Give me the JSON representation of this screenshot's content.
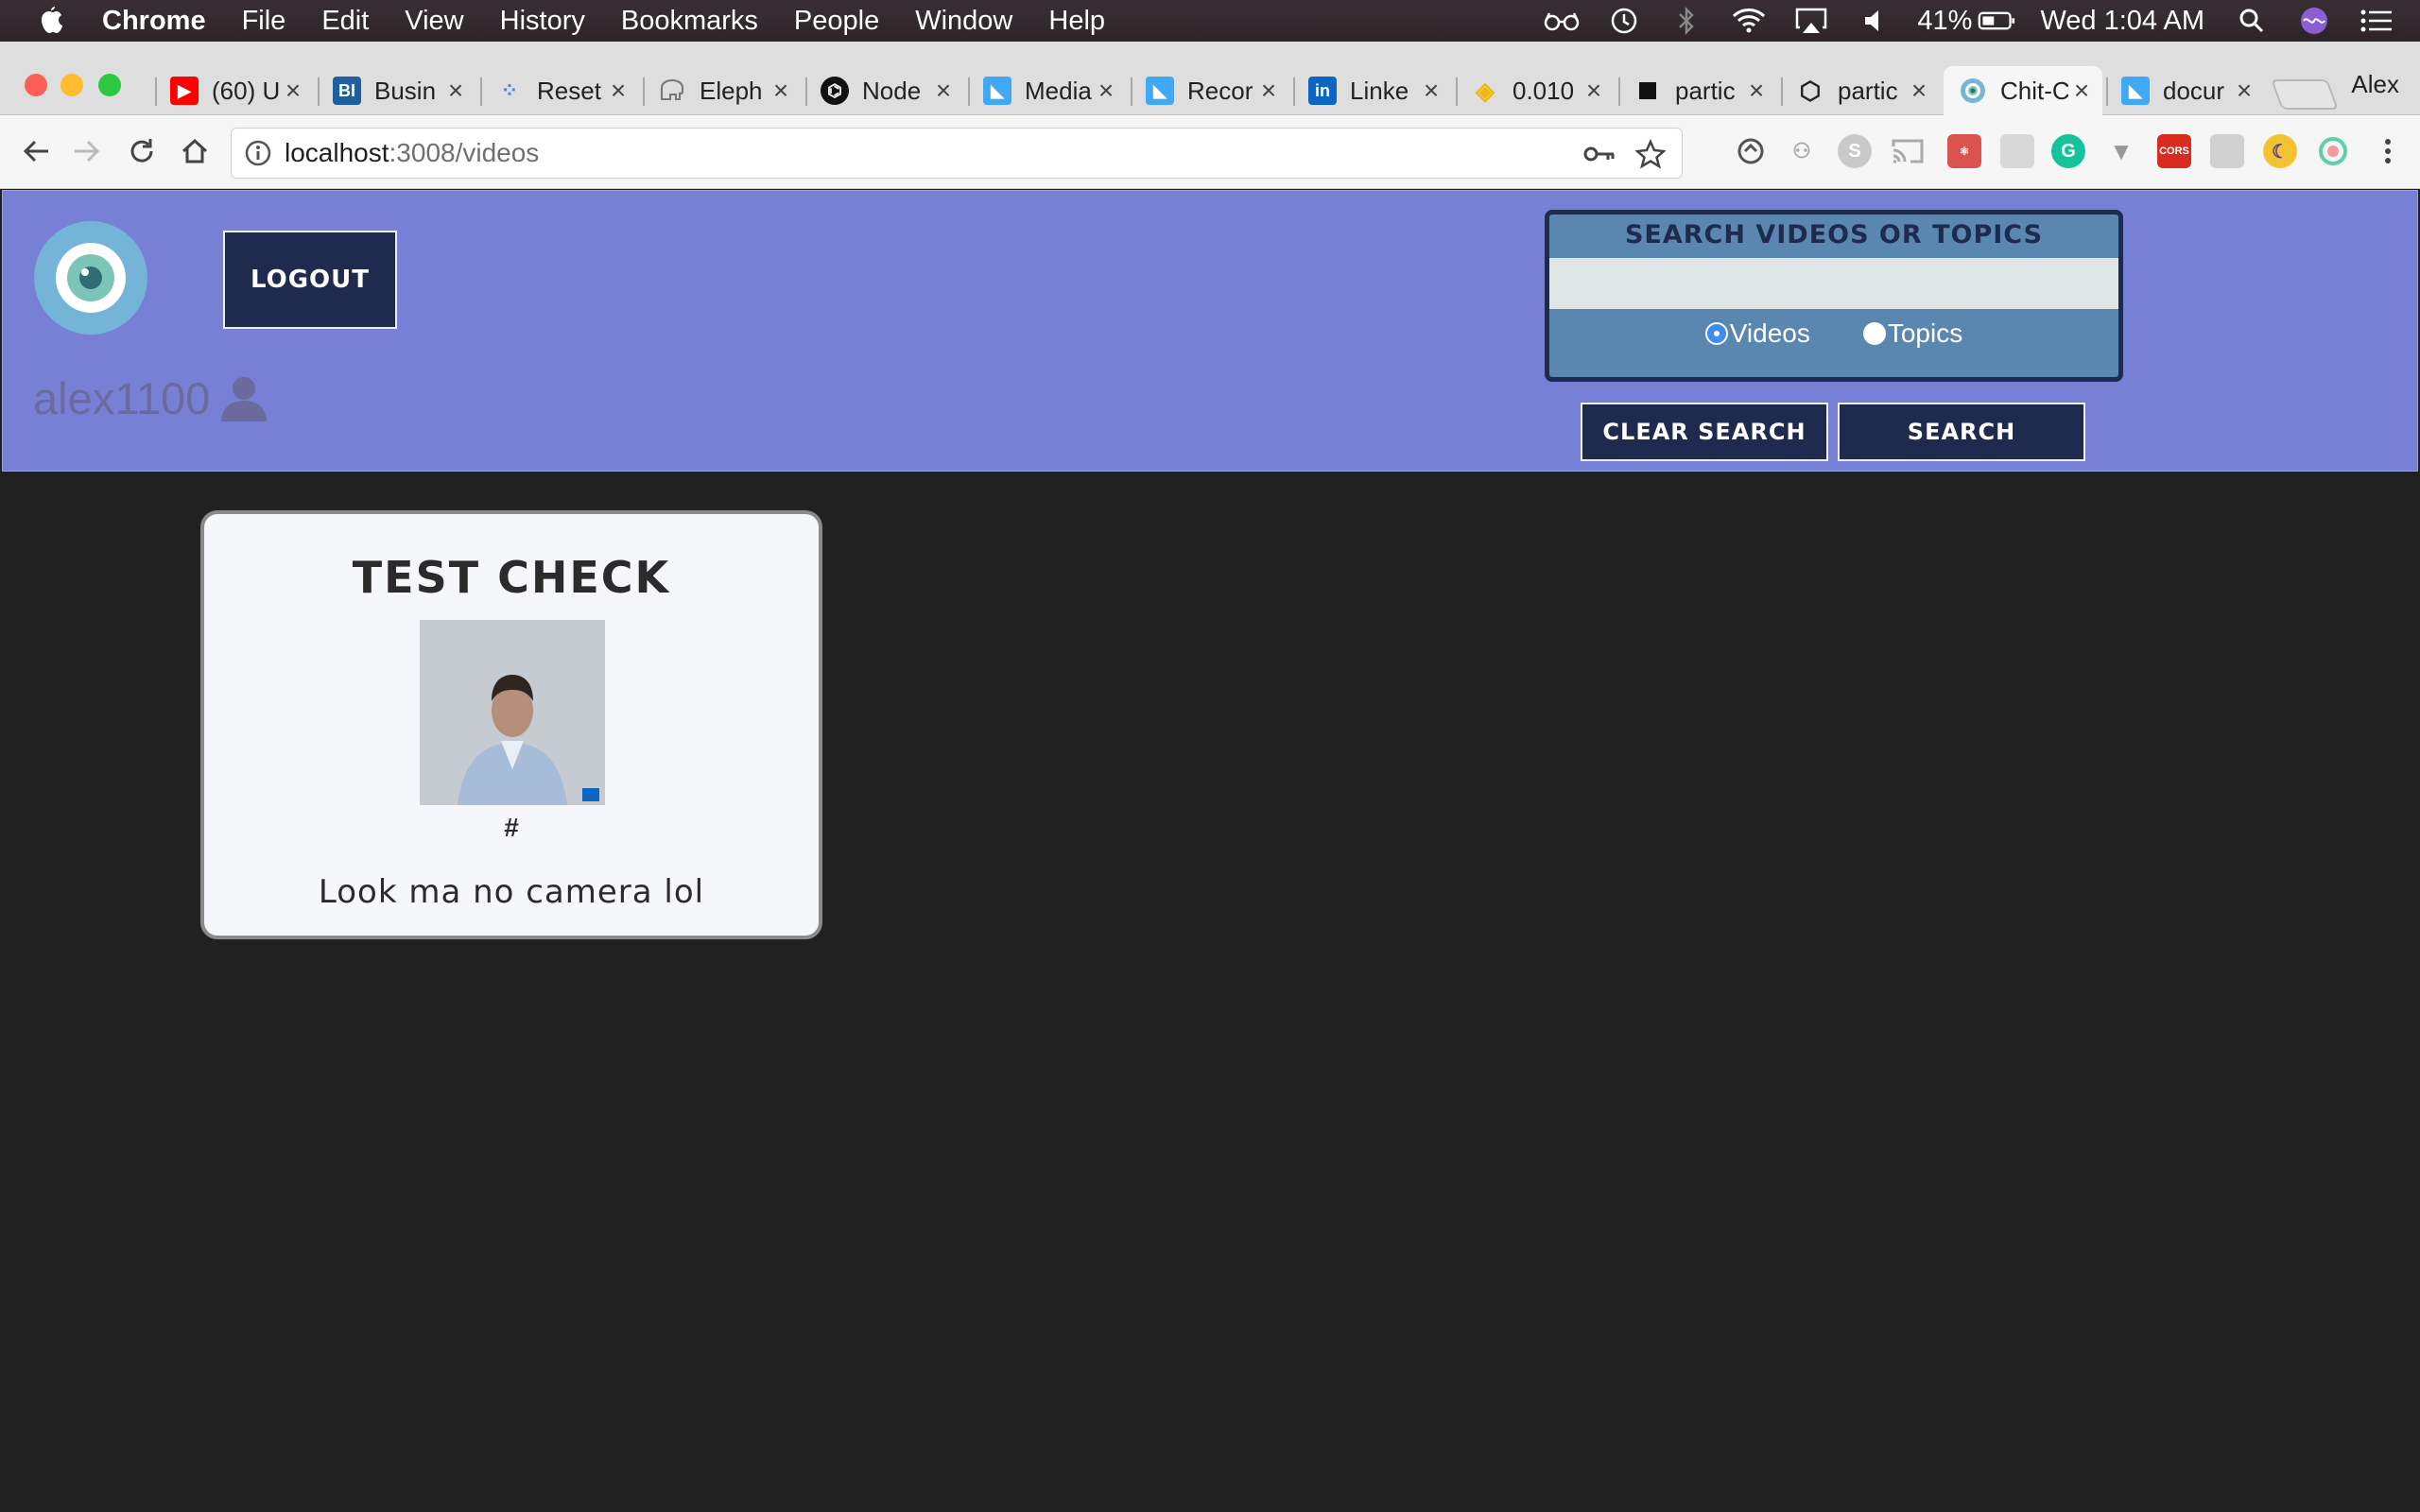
{
  "menubar": {
    "app_name": "Chrome",
    "items": [
      "File",
      "Edit",
      "View",
      "History",
      "Bookmarks",
      "People",
      "Window",
      "Help"
    ],
    "battery": "41%",
    "clock": "Wed 1:04 AM"
  },
  "tabs": [
    {
      "label": "(60) U",
      "icon": "youtube-icon",
      "color": "#ff0000"
    },
    {
      "label": "Busin",
      "icon": "business-insider-icon",
      "color": "#1d5f9f"
    },
    {
      "label": "Reset",
      "icon": "dots-icon",
      "color": "#3a8dde"
    },
    {
      "label": "Eleph",
      "icon": "elephant-icon",
      "color": "#777777"
    },
    {
      "label": "Node",
      "icon": "github-icon",
      "color": "#111111"
    },
    {
      "label": "Media",
      "icon": "bird-icon",
      "color": "#3fa9f5"
    },
    {
      "label": "Recor",
      "icon": "bird-icon",
      "color": "#3fa9f5"
    },
    {
      "label": "Linke",
      "icon": "linkedin-icon",
      "color": "#0a66c2"
    },
    {
      "label": "0.010",
      "icon": "binance-icon",
      "color": "#f0b90b"
    },
    {
      "label": "partic",
      "icon": "square-icon",
      "color": "#111111"
    },
    {
      "label": "partic",
      "icon": "codepen-icon",
      "color": "#222222"
    },
    {
      "label": "Chit-C",
      "icon": "eye-logo-icon",
      "color": "#74b5d7",
      "active": true
    },
    {
      "label": "docur",
      "icon": "bird-icon",
      "color": "#3fa9f5"
    }
  ],
  "profile_name": "Alex",
  "address_bar": {
    "host": "localhost",
    "path": ":3008/videos"
  },
  "header": {
    "logout_label": "Logout",
    "username": "alex1100",
    "search_title": "Search Videos or Topics",
    "search_value": "",
    "radio_videos": "Videos",
    "radio_topics": "Topics",
    "selected_radio": "Videos",
    "clear_search_label": "Clear Search",
    "search_label": "Search"
  },
  "videos": [
    {
      "title": "Test Check",
      "hashtag": "#",
      "description": "Look ma no camera lol"
    }
  ],
  "colors": {
    "header_bg": "#7880d6",
    "button_bg": "#1e2a4e",
    "search_panel_bg": "#5a87b0",
    "page_bg": "#212121",
    "card_bg": "#f6f7fb"
  }
}
